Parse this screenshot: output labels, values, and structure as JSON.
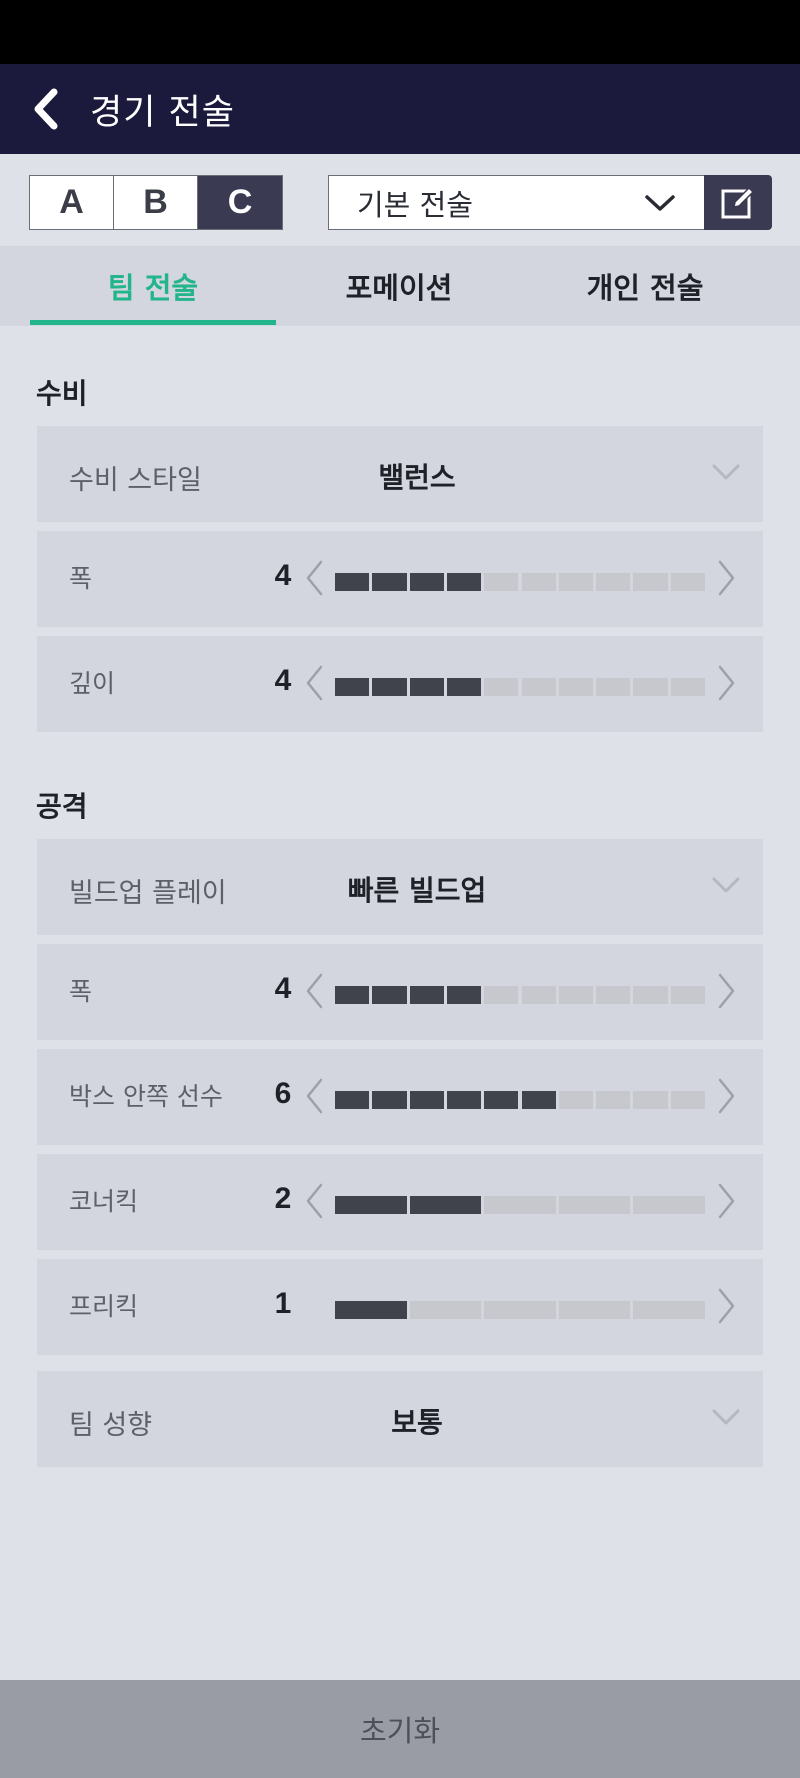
{
  "header": {
    "title": "경기 전술"
  },
  "tactic_slots": [
    {
      "label": "A",
      "active": false
    },
    {
      "label": "B",
      "active": false
    },
    {
      "label": "C",
      "active": true
    }
  ],
  "preset": {
    "selected": "기본 전술"
  },
  "tabs": [
    {
      "label": "팀 전술",
      "active": true
    },
    {
      "label": "포메이션",
      "active": false
    },
    {
      "label": "개인 전술",
      "active": false
    }
  ],
  "defense": {
    "title": "수비",
    "style": {
      "label": "수비 스타일",
      "value": "밸런스"
    },
    "width": {
      "label": "폭",
      "value": 4,
      "max": 10,
      "segments": 10
    },
    "depth": {
      "label": "깊이",
      "value": 4,
      "max": 10,
      "segments": 10
    }
  },
  "attack": {
    "title": "공격",
    "buildup": {
      "label": "빌드업 플레이",
      "value": "빠른 빌드업"
    },
    "width": {
      "label": "폭",
      "value": 4,
      "max": 10,
      "segments": 10
    },
    "box_players": {
      "label": "박스 안쪽 선수",
      "value": 6,
      "max": 10,
      "segments": 10
    },
    "corner": {
      "label": "코너킥",
      "value": 2,
      "max": 5,
      "segments": 5
    },
    "freekick": {
      "label": "프리킥",
      "value": 1,
      "max": 5,
      "segments": 5
    }
  },
  "team_tendency": {
    "label": "팀 성향",
    "value": "보통"
  },
  "footer": {
    "reset_label": "초기화"
  },
  "colors": {
    "accent": "#22b58b",
    "appbar": "#1b1a3c",
    "bar_on": "#41434c",
    "bar_off": "#c7c8ce"
  }
}
